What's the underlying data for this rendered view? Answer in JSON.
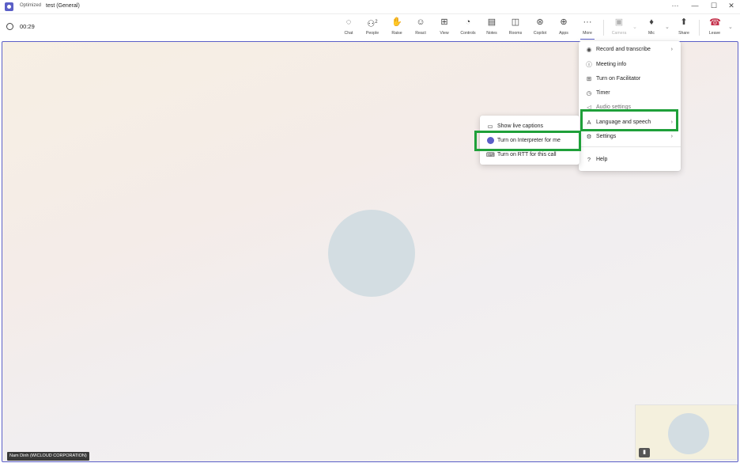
{
  "window": {
    "status": "Optimized",
    "title": "test (General)",
    "controls": [
      "···",
      "—",
      "☐",
      "✕"
    ]
  },
  "toolbar": {
    "timer": "00:29",
    "buttons": [
      {
        "id": "chat",
        "label": "Chat",
        "icon": "chat-icon",
        "glyph": "◌"
      },
      {
        "id": "people",
        "label": "People",
        "icon": "people-icon",
        "glyph": "⚇",
        "badge": "2"
      },
      {
        "id": "raise",
        "label": "Raise",
        "icon": "hand-icon",
        "glyph": "✋"
      },
      {
        "id": "react",
        "label": "React",
        "icon": "smiley-icon",
        "glyph": "☺"
      },
      {
        "id": "view",
        "label": "View",
        "icon": "grid-icon",
        "glyph": "⊞"
      },
      {
        "id": "controls",
        "label": "Controls",
        "icon": "controls-icon",
        "glyph": "◔"
      },
      {
        "id": "notes",
        "label": "Notes",
        "icon": "notes-icon",
        "glyph": "▤"
      },
      {
        "id": "rooms",
        "label": "Rooms",
        "icon": "rooms-icon",
        "glyph": "◫"
      },
      {
        "id": "copilot",
        "label": "Copilot",
        "icon": "copilot-icon",
        "glyph": "⊛"
      },
      {
        "id": "apps",
        "label": "Apps",
        "icon": "apps-icon",
        "glyph": "⊕"
      },
      {
        "id": "more",
        "label": "More",
        "icon": "more-icon",
        "glyph": "···"
      },
      {
        "id": "camera",
        "label": "Camera",
        "icon": "camera-off-icon",
        "glyph": "▣"
      },
      {
        "id": "mic",
        "label": "Mic",
        "icon": "mic-icon",
        "glyph": "♦"
      },
      {
        "id": "share",
        "label": "Share",
        "icon": "share-icon",
        "glyph": "⬆"
      },
      {
        "id": "leave",
        "label": "Leave",
        "icon": "phone-hangup-icon",
        "glyph": "☎"
      }
    ]
  },
  "stage": {
    "participant_name": "Nam Dinh (WICLOUD CORPORATION)"
  },
  "more_menu": {
    "items": [
      {
        "label": "Record and transcribe",
        "icon": "record-icon",
        "glyph": "◉",
        "chevron": true
      },
      {
        "label": "Meeting info",
        "icon": "info-icon",
        "glyph": "ⓘ",
        "chevron": false
      },
      {
        "label": "Turn on Facilitator",
        "icon": "facilitator-icon",
        "glyph": "⊞",
        "chevron": false
      },
      {
        "label": "Timer",
        "icon": "timer-icon",
        "glyph": "◷",
        "chevron": false
      },
      {
        "label": "Audio settings",
        "icon": "speaker-icon",
        "glyph": "◁",
        "chevron": false
      },
      {
        "label": "Language and speech",
        "icon": "language-icon",
        "glyph": "A",
        "chevron": true
      },
      {
        "label": "Settings",
        "icon": "gear-icon",
        "glyph": "⚙",
        "chevron": true
      },
      {
        "label": "Help",
        "icon": "help-icon",
        "glyph": "?",
        "chevron": false
      }
    ]
  },
  "language_submenu": {
    "items": [
      {
        "label": "Show live captions",
        "icon": "captions-icon",
        "glyph": "▭"
      },
      {
        "label": "Turn on Interpreter for me",
        "icon": "interpreter-icon",
        "glyph": ""
      },
      {
        "label": "Turn on RTT for this call",
        "icon": "rtt-icon",
        "glyph": "⌨"
      }
    ]
  },
  "colors": {
    "accent": "#5b5fc7",
    "highlight": "#1fa03a",
    "leave": "#c4314b"
  }
}
